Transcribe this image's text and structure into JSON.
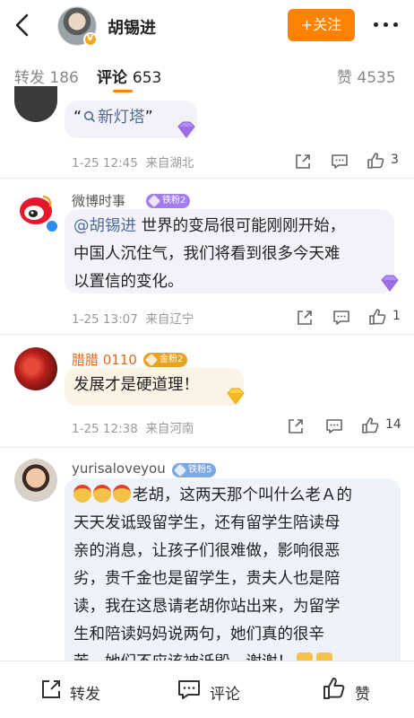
{
  "header": {
    "author_name": "胡锡进",
    "follow_label": "+关注",
    "icons": [
      "back-arrow-icon",
      "more-dots-icon",
      "verified-badge-icon"
    ]
  },
  "tabs": [
    {
      "label": "转发",
      "count": "186"
    },
    {
      "label": "评论",
      "count": "653",
      "active": true
    },
    {
      "label": "赞",
      "count": "4535"
    }
  ],
  "comments": [
    {
      "text_parts": [
        "“",
        "新灯塔",
        "”"
      ],
      "time": "1-25 12:45",
      "location": "来自湖北",
      "likes": "3"
    },
    {
      "name": "微博时事",
      "fan_badge": "铁粉2",
      "mention": "@胡锡进",
      "text": "世界的变局很可能刚刚开始，中国人沉住气，我们将看到很多今天难以置信的变化。",
      "line1": "世界的变局很可能刚刚开始，",
      "line2": "中国人沉住气，我们将看到很多今天难",
      "line3": "以置信的变化。",
      "time": "1-25 13:07",
      "location": "来自辽宁",
      "likes": "1"
    },
    {
      "name": "腊腊 0110",
      "fan_badge": "金粉2",
      "text": "发展才是硬道理！",
      "time": "1-25 12:38",
      "location": "来自河南",
      "likes": "14"
    },
    {
      "name": "yurisaloveyou",
      "fan_badge": "铁粉5",
      "lines": [
        "老胡，这两天那个叫什么老Ａ的",
        "天天发诋毁留学生，还有留学生陪读母",
        "亲的消息，让孩子们很难做，影响很恶",
        "劣，贵千金也是留学生，贵夫人也是陪",
        "读，我在这恳请老胡你站出来，为留学",
        "生和陪读妈妈说两句，她们真的很辛",
        "苦，她们不应该被诋毁，谢谢！"
      ]
    }
  ],
  "bottom_bar": {
    "repost_label": "转发",
    "comment_label": "评论",
    "like_label": "赞"
  },
  "colors": {
    "accent": "#ff8200",
    "link": "#4e6a95",
    "bubble": "#f3f2fa"
  }
}
